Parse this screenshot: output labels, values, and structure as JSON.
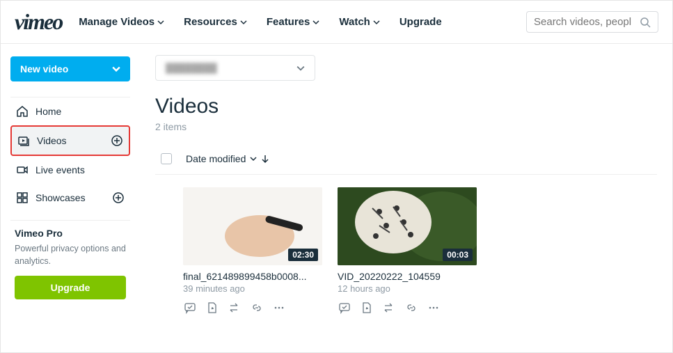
{
  "header": {
    "logo": "vimeo",
    "nav": [
      {
        "label": "Manage Videos",
        "dropdown": true
      },
      {
        "label": "Resources",
        "dropdown": true
      },
      {
        "label": "Features",
        "dropdown": true
      },
      {
        "label": "Watch",
        "dropdown": true
      },
      {
        "label": "Upgrade",
        "dropdown": false
      }
    ],
    "search_placeholder": "Search videos, peopl"
  },
  "sidebar": {
    "new_video_label": "New video",
    "items": [
      {
        "label": "Home",
        "icon": "home",
        "plus": false,
        "active": false
      },
      {
        "label": "Videos",
        "icon": "video",
        "plus": true,
        "active": true
      },
      {
        "label": "Live events",
        "icon": "live",
        "plus": false,
        "active": false
      },
      {
        "label": "Showcases",
        "icon": "showcase",
        "plus": true,
        "active": false
      }
    ],
    "promo": {
      "title": "Vimeo Pro",
      "text": "Powerful privacy options and analytics.",
      "button": "Upgrade"
    }
  },
  "main": {
    "scope_selected": "",
    "page_title": "Videos",
    "item_count": "2 items",
    "sort_label": "Date modified",
    "videos": [
      {
        "title": "final_621489899458b0008...",
        "time_ago": "39 minutes ago",
        "duration": "02:30"
      },
      {
        "title": "VID_20220222_104559",
        "time_ago": "12 hours ago",
        "duration": "00:03"
      }
    ]
  }
}
